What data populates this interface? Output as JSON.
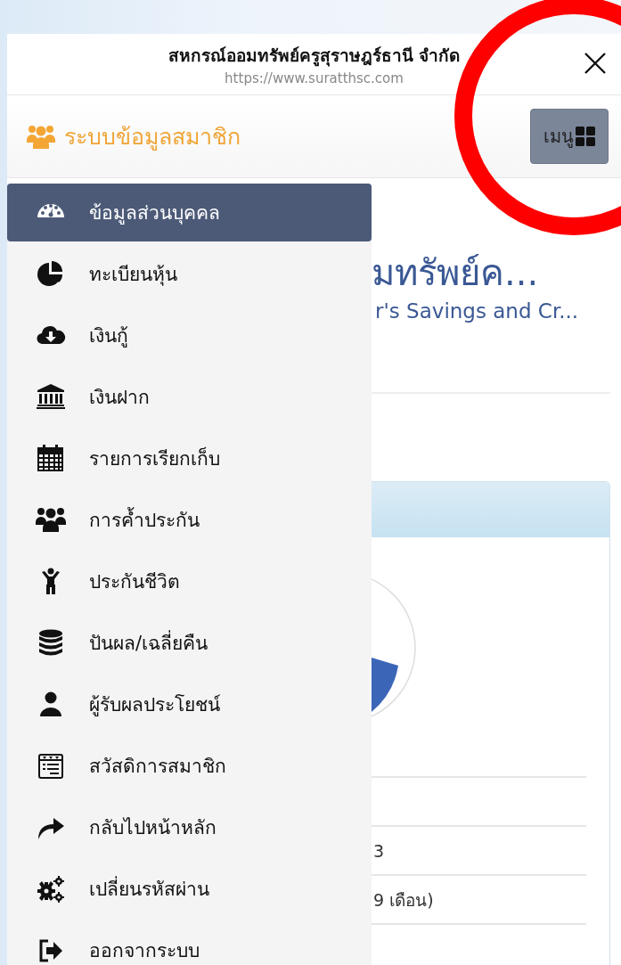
{
  "browser_bar": {
    "title": "สหกรณ์ออมทรัพย์ครูสุราษฎร์ธานี จำกัด",
    "url": "https://www.suratthsc.com"
  },
  "app_bar": {
    "title": "ระบบข้อมูลสมาชิก",
    "menu_button": "เมนู"
  },
  "menu": [
    {
      "label": "ข้อมูลส่วนบุคคล",
      "kind": "dashboard",
      "selected": true
    },
    {
      "label": "ทะเบียนหุ้น",
      "kind": "pie",
      "selected": false
    },
    {
      "label": "เงินกู้",
      "kind": "cloud",
      "selected": false
    },
    {
      "label": "เงินฝาก",
      "kind": "bank",
      "selected": false
    },
    {
      "label": "รายการเรียกเก็บ",
      "kind": "calendar",
      "selected": false
    },
    {
      "label": "การค้ำประกัน",
      "kind": "group",
      "selected": false
    },
    {
      "label": "ประกันชีวิต",
      "kind": "child",
      "selected": false
    },
    {
      "label": "ปันผล/เฉลี่ยคืน",
      "kind": "database",
      "selected": false
    },
    {
      "label": "ผู้รับผลประโยชน์",
      "kind": "user",
      "selected": false
    },
    {
      "label": "สวัสดิการสมาชิก",
      "kind": "list",
      "selected": false
    },
    {
      "label": "กลับไปหน้าหลัก",
      "kind": "share",
      "selected": false
    },
    {
      "label": "เปลี่ยนรหัสผ่าน",
      "kind": "gears",
      "selected": false
    },
    {
      "label": "ออกจากระบบ",
      "kind": "signout",
      "selected": false
    }
  ],
  "content": {
    "title": "มทรัพย์ค...",
    "subtitle": "r's Savings and Cr...",
    "rows": [
      {
        "value": "3"
      },
      {
        "value": "9 เดือน)"
      }
    ]
  },
  "annotation": {
    "kind": "circle"
  }
}
